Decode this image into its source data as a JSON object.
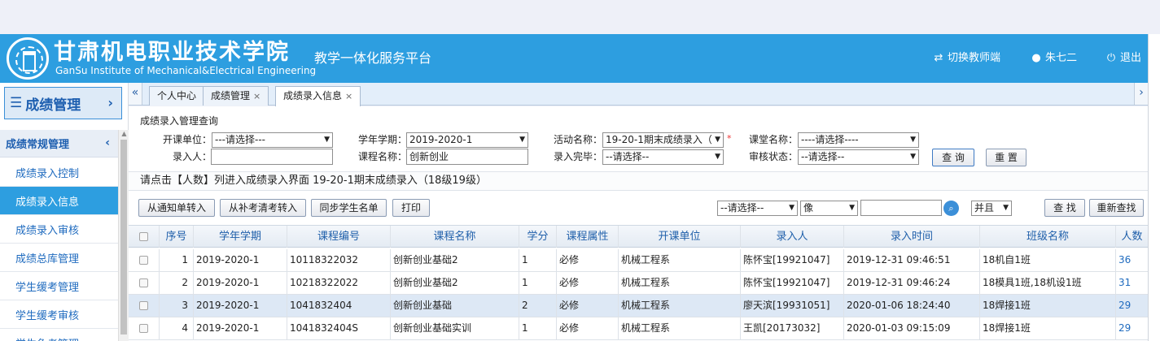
{
  "header": {
    "school_name_cn": "甘肃机电职业技术学院",
    "school_name_en": "GanSu Institute of Mechanical&Electrical Engineering",
    "platform": "教学一体化服务平台",
    "switch_label": "切换教师端",
    "user_name": "朱七二",
    "logout_label": "退出"
  },
  "sidebar": {
    "header": "成绩管理",
    "group": "成绩常规管理",
    "items": [
      {
        "label": "成绩录入控制"
      },
      {
        "label": "成绩录入信息"
      },
      {
        "label": "成绩录入审核"
      },
      {
        "label": "成绩总库管理"
      },
      {
        "label": "学生缓考管理"
      },
      {
        "label": "学生缓考审核"
      },
      {
        "label": "学生免考管理"
      }
    ]
  },
  "tabs": [
    {
      "label": "个人中心"
    },
    {
      "label": "成绩管理"
    },
    {
      "label": "成绩录入信息"
    }
  ],
  "query": {
    "title": "成绩录入管理查询",
    "fields": {
      "dept_label": "开课单位：",
      "dept_value": "---请选择---",
      "term_label": "学年学期：",
      "term_value": "2019-2020-1",
      "activity_label": "活动名称：",
      "activity_value": "19-20-1期末成绩录入（",
      "class_label": "课堂名称：",
      "class_value": "----请选择----",
      "entry_person_label": "录入人：",
      "entry_person_value": "",
      "course_name_label": "课程名称：",
      "course_name_value": "创新创业",
      "entry_done_label": "录入完毕：",
      "entry_done_value": "--请选择--",
      "review_label": "审核状态：",
      "review_value": "--请选择--"
    },
    "query_button": "查 询",
    "reset_button": "重 置"
  },
  "notice": "请点击【人数】列进入成绩录入界面 19-20-1期末成绩录入（18级19级）",
  "toolbar": {
    "from_notice": "从通知单转入",
    "from_makeup": "从补考清考转入",
    "sync_students": "同步学生名单",
    "print": "打印",
    "filter_field": "--请选择--",
    "filter_op": "像",
    "filter_value": "",
    "logic": "并且",
    "find": "查 找",
    "refind": "重新查找"
  },
  "table": {
    "columns": [
      "序号",
      "学年学期",
      "课程编号",
      "课程名称",
      "学分",
      "课程属性",
      "开课单位",
      "录入人",
      "录入时间",
      "班级名称",
      "人数"
    ],
    "rows": [
      {
        "no": "1",
        "term": "2019-2020-1",
        "code": "10118322032",
        "name": "创新创业基础2",
        "credit": "1",
        "attr": "必修",
        "dept": "机械工程系",
        "person": "陈怀宝[19921047]",
        "time": "2019-12-31 09:46:51",
        "class": "18机自1班",
        "count": "36"
      },
      {
        "no": "2",
        "term": "2019-2020-1",
        "code": "10218322022",
        "name": "创新创业基础2",
        "credit": "1",
        "attr": "必修",
        "dept": "机械工程系",
        "person": "陈怀宝[19921047]",
        "time": "2019-12-31 09:46:24",
        "class": "18模具1班,18机设1班",
        "count": "31"
      },
      {
        "no": "3",
        "term": "2019-2020-1",
        "code": "1041832404",
        "name": "创新创业基础",
        "credit": "2",
        "attr": "必修",
        "dept": "机械工程系",
        "person": "廖天滨[19931051]",
        "time": "2020-01-06 18:24:40",
        "class": "18焊接1班",
        "count": "29"
      },
      {
        "no": "4",
        "term": "2019-2020-1",
        "code": "1041832404S",
        "name": "创新创业基础实训",
        "credit": "1",
        "attr": "必修",
        "dept": "机械工程系",
        "person": "王凯[20173032]",
        "time": "2020-01-03 09:15:09",
        "class": "18焊接1班",
        "count": "29"
      }
    ]
  },
  "colors": {
    "header_bg": "#2d9ee0",
    "active_item": "#2d9ee0",
    "link": "#1f6bbf",
    "required": "#e33333"
  }
}
